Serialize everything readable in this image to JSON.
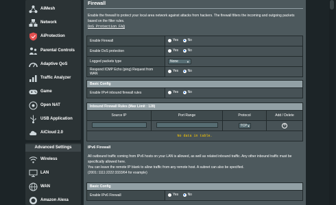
{
  "sidebar": {
    "top_items": [
      {
        "label": "AiMesh",
        "icon": "mesh-icon"
      },
      {
        "label": "Network",
        "icon": "network-icon"
      },
      {
        "label": "AiProtection",
        "icon": "shield-icon"
      },
      {
        "label": "Parental Controls",
        "icon": "parental-icon"
      },
      {
        "label": "Adaptive QoS",
        "icon": "qos-icon"
      },
      {
        "label": "Traffic Analyzer",
        "icon": "traffic-icon"
      },
      {
        "label": "Game",
        "icon": "game-icon"
      },
      {
        "label": "Open NAT",
        "icon": "nat-icon"
      },
      {
        "label": "USB Application",
        "icon": "usb-icon"
      },
      {
        "label": "AiCloud 2.0",
        "icon": "cloud-icon"
      }
    ],
    "advanced_title": "Advanced Settings",
    "advanced_items": [
      {
        "label": "Wireless",
        "icon": "wifi-icon"
      },
      {
        "label": "LAN",
        "icon": "lan-icon"
      },
      {
        "label": "WAN",
        "icon": "globe-icon"
      },
      {
        "label": "Amazon Alexa",
        "icon": "alexa-icon"
      }
    ]
  },
  "main": {
    "title": "Firewall",
    "description": "Enable the firewall to protect your local area network against attacks from hackers. The firewall filters the incoming and outgoing packets based on the filter rules.",
    "faq_link": "DoS Protection FAQ",
    "radio_yes": "Yes",
    "radio_no": "No",
    "settings": [
      {
        "label": "Enable Firewall",
        "value": "No"
      },
      {
        "label": "Enable DoS protection",
        "value": "No"
      },
      {
        "label": "Logged packets type",
        "select": "None"
      },
      {
        "label": "Respond ICMP Echo (ping) Request from WAN",
        "value": "No"
      }
    ],
    "basic_config_title": "Basic Config",
    "ipv4_inbound_label": "Enable IPv4 inbound firewall rules",
    "ipv4_inbound_value": "No",
    "inbound_rules": {
      "title": "Inbound Firewall Rules (Max Limit : 128)",
      "columns": [
        "Source IP",
        "Port Range",
        "Protocol",
        "Add / Delete"
      ],
      "protocol_value": "TCP",
      "empty_text": "No data in table."
    },
    "ipv6": {
      "title": "IPv6 Firewall",
      "desc1": "All outbound traffic coming from IPv6 hosts on your LAN is allowed, as well as related inbound traffic. Any other inbound traffic must be specifically allowed here.",
      "desc2": "You can leave the remote IP blank to allow traffic from any remote host. A subnet can also be specified.",
      "desc3": "(2001::1111:2222:3333/64 for example)",
      "basic_config_title": "Basic Config",
      "enable_label": "Enable IPv6 Firewall",
      "enable_value": "No"
    }
  },
  "colors": {
    "page_bg": "#1c2427",
    "panel_bg": "#4d595d",
    "header_bar": "#92a0a5",
    "radio_selected": "#1a73e8"
  }
}
